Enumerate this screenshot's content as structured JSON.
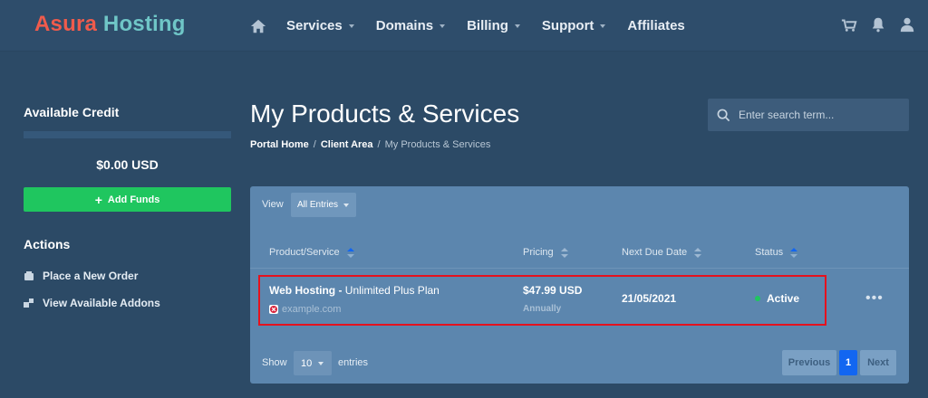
{
  "brand": {
    "part1": "Asura",
    "part2": "Hosting"
  },
  "nav": {
    "items": [
      {
        "label": "Services",
        "has_caret": true
      },
      {
        "label": "Domains",
        "has_caret": true
      },
      {
        "label": "Billing",
        "has_caret": true
      },
      {
        "label": "Support",
        "has_caret": true
      },
      {
        "label": "Affiliates",
        "has_caret": false
      }
    ],
    "icons": [
      "home-icon",
      "cart-icon",
      "bell-icon",
      "user-icon"
    ]
  },
  "sidebar": {
    "credit_title": "Available Credit",
    "credit_value": "$0.00 USD",
    "add_funds_label": "Add Funds",
    "actions_title": "Actions",
    "actions": [
      {
        "label": "Place a New Order",
        "icon": "cart-icon"
      },
      {
        "label": "View Available Addons",
        "icon": "cubes-icon"
      }
    ]
  },
  "page": {
    "title": "My Products & Services",
    "breadcrumb": [
      "Portal Home",
      "Client Area",
      "My Products & Services"
    ]
  },
  "search": {
    "placeholder": "Enter search term..."
  },
  "table": {
    "view_label": "View",
    "view_selected": "All Entries",
    "columns": [
      "Product/Service",
      "Pricing",
      "Next Due Date",
      "Status"
    ],
    "rows": [
      {
        "service": "Web Hosting",
        "service_separator": " - ",
        "plan": "Unlimited Plus Plan",
        "domain": "example.com",
        "price": "$47.99 USD",
        "cycle": "Annually",
        "due_date": "21/05/2021",
        "status": "Active",
        "more": "•••"
      }
    ],
    "show_label": "Show",
    "page_size": "10",
    "entries_label": "entries"
  },
  "pagination": {
    "previous": "Previous",
    "current": "1",
    "next": "Next"
  },
  "colors": {
    "background": "#2c4a66",
    "panel": "#5c86ae",
    "accent_green": "#1fc65f",
    "accent_blue": "#1266f1",
    "highlight_red": "#e5121e",
    "brand_red": "#ef5b4c",
    "brand_teal": "#6fc6c7"
  }
}
